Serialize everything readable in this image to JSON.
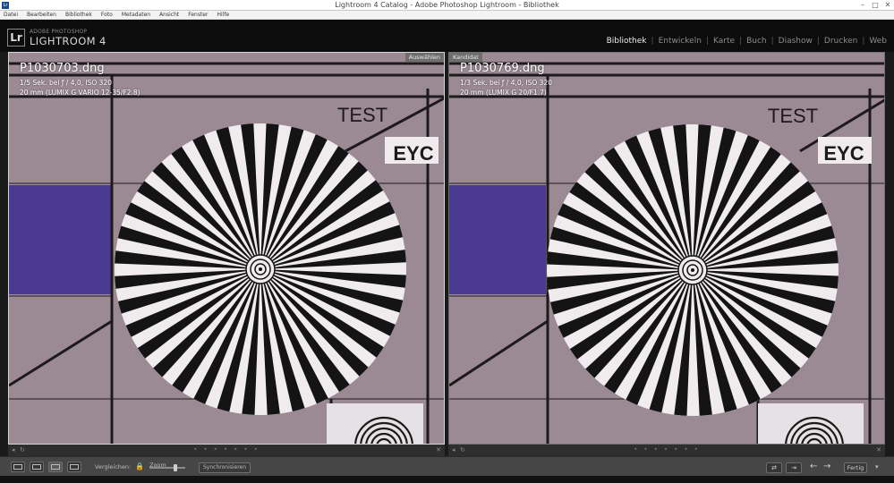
{
  "window": {
    "title": "Lightroom 4 Catalog - Adobe Photoshop Lightroom - Bibliothek",
    "icon": "Lr",
    "minimize_label": "–",
    "maximize_label": "□",
    "close_label": "✕"
  },
  "menu": [
    "Datei",
    "Bearbeiten",
    "Bibliothek",
    "Foto",
    "Metadaten",
    "Ansicht",
    "Fenster",
    "Hilfe"
  ],
  "identity": {
    "logo": "Lr",
    "company": "ADOBE PHOTOSHOP",
    "product": "LIGHTROOM 4"
  },
  "modules": [
    "Bibliothek",
    "Entwickeln",
    "Karte",
    "Buch",
    "Diashow",
    "Drucken",
    "Web"
  ],
  "active_module": "Bibliothek",
  "compare": {
    "left": {
      "tag": "Auswählen",
      "filename": "P1030703.dng",
      "exposure": "1/5 Sek. bei ƒ / 4,0, ISO 320",
      "lens": "20 mm (LUMIX G VARIO 12-35/F2.8)"
    },
    "right": {
      "tag": "Kandidat",
      "filename": "P1030769.dng",
      "exposure": "1/3 Sek. bei ƒ / 4,0, ISO 320",
      "lens": "20 mm (LUMIX G 20/F1.7)"
    },
    "chart_text": {
      "test": "TEST",
      "eyc": "EYC"
    }
  },
  "strip": {
    "dots": "• • • • • • •",
    "close_label": "✕"
  },
  "toolbar": {
    "compare_label": "Vergleichen:",
    "lock_icon": "🔒",
    "zoom_label": "Zoom",
    "sync_label": "Synchronisieren",
    "swap_label": "⇄",
    "make_main_label": "⇥",
    "prev_label": "←",
    "next_label": "→",
    "ok_label": "Fertig",
    "chevron": "▾"
  },
  "colors": {
    "background": "#1a1a1a",
    "chart_paper": "#9b8a93",
    "chart_lines": "#1e1a1c",
    "purple_patch": "#4a3a8f",
    "wedge_black": "#141414",
    "wedge_white": "#f0ecee",
    "lock_gold": "#d8b54a"
  }
}
